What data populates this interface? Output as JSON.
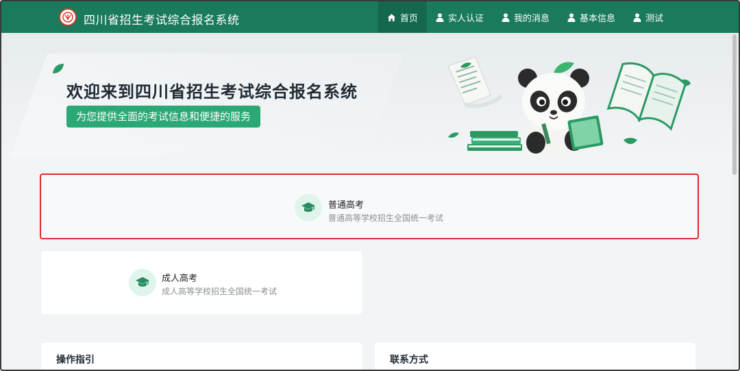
{
  "header": {
    "system_title": "四川省招生考试综合报名系统",
    "nav": [
      {
        "label": "首页",
        "icon": "home-icon",
        "active": true
      },
      {
        "label": "实人认证",
        "icon": "user-icon",
        "active": false
      },
      {
        "label": "我的消息",
        "icon": "user-icon",
        "active": false
      },
      {
        "label": "基本信息",
        "icon": "user-icon",
        "active": false
      },
      {
        "label": "测试",
        "icon": "user-icon",
        "active": false
      }
    ]
  },
  "banner": {
    "welcome": "欢迎来到四川省招生考试综合报名系统",
    "subtitle": "为您提供全面的考试信息和便捷的服务"
  },
  "exams": [
    {
      "title": "普通高考",
      "desc": "普通高等学校招生全国统一考试",
      "icon": "graduation-cap-icon"
    },
    {
      "title": "成人高考",
      "desc": "成人高等学校招生全国统一考试",
      "icon": "graduation-cap-icon"
    }
  ],
  "panels": {
    "guide_title": "操作指引",
    "contact_title": "联系方式"
  },
  "colors": {
    "brand": "#1a7a5c",
    "accent": "#2aa876",
    "highlight_border": "#e02a2a"
  }
}
